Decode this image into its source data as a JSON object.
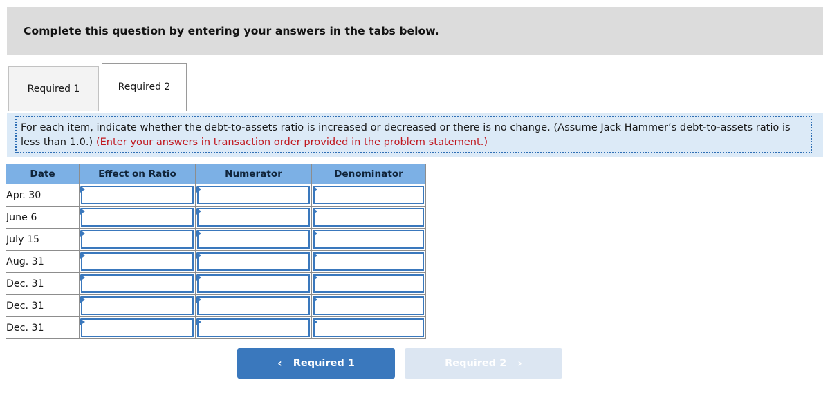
{
  "banner": {
    "title": "Complete this question by entering your answers in the tabs below."
  },
  "tabs": [
    {
      "label": "Required 1",
      "active": false
    },
    {
      "label": "Required 2",
      "active": true
    }
  ],
  "callout": {
    "text_main": "For each item, indicate whether the debt-to-assets ratio is increased or decreased or there is no change. (Assume Jack Hammer’s debt-to-assets ratio is less than 1.0.) ",
    "text_emphasis": "(Enter your answers in transaction order provided in the problem statement.)"
  },
  "table": {
    "columns": [
      "Date",
      "Effect on Ratio",
      "Numerator",
      "Denominator"
    ],
    "rows": [
      {
        "date": "Apr. 30",
        "effect": "",
        "numerator": "",
        "denominator": ""
      },
      {
        "date": "June 6",
        "effect": "",
        "numerator": "",
        "denominator": ""
      },
      {
        "date": "July 15",
        "effect": "",
        "numerator": "",
        "denominator": ""
      },
      {
        "date": "Aug. 31",
        "effect": "",
        "numerator": "",
        "denominator": ""
      },
      {
        "date": "Dec. 31",
        "effect": "",
        "numerator": "",
        "denominator": ""
      },
      {
        "date": "Dec. 31",
        "effect": "",
        "numerator": "",
        "denominator": ""
      },
      {
        "date": "Dec. 31",
        "effect": "",
        "numerator": "",
        "denominator": ""
      }
    ]
  },
  "pager": {
    "prev_label": "Required 1",
    "prev_icon": "chevron-left-icon",
    "prev_glyph": "‹",
    "next_label": "Required 2",
    "next_icon": "chevron-right-icon",
    "next_glyph": "›"
  },
  "colors": {
    "banner_bg": "#dcdcdc",
    "callout_bg": "#dceaf7",
    "callout_border": "#2f6fb5",
    "emphasis_text": "#c0181f",
    "table_header_bg": "#7cb0e5",
    "input_border": "#3a78bd",
    "button_active_bg": "#3a78bd",
    "button_disabled_bg": "#dce6f2"
  }
}
